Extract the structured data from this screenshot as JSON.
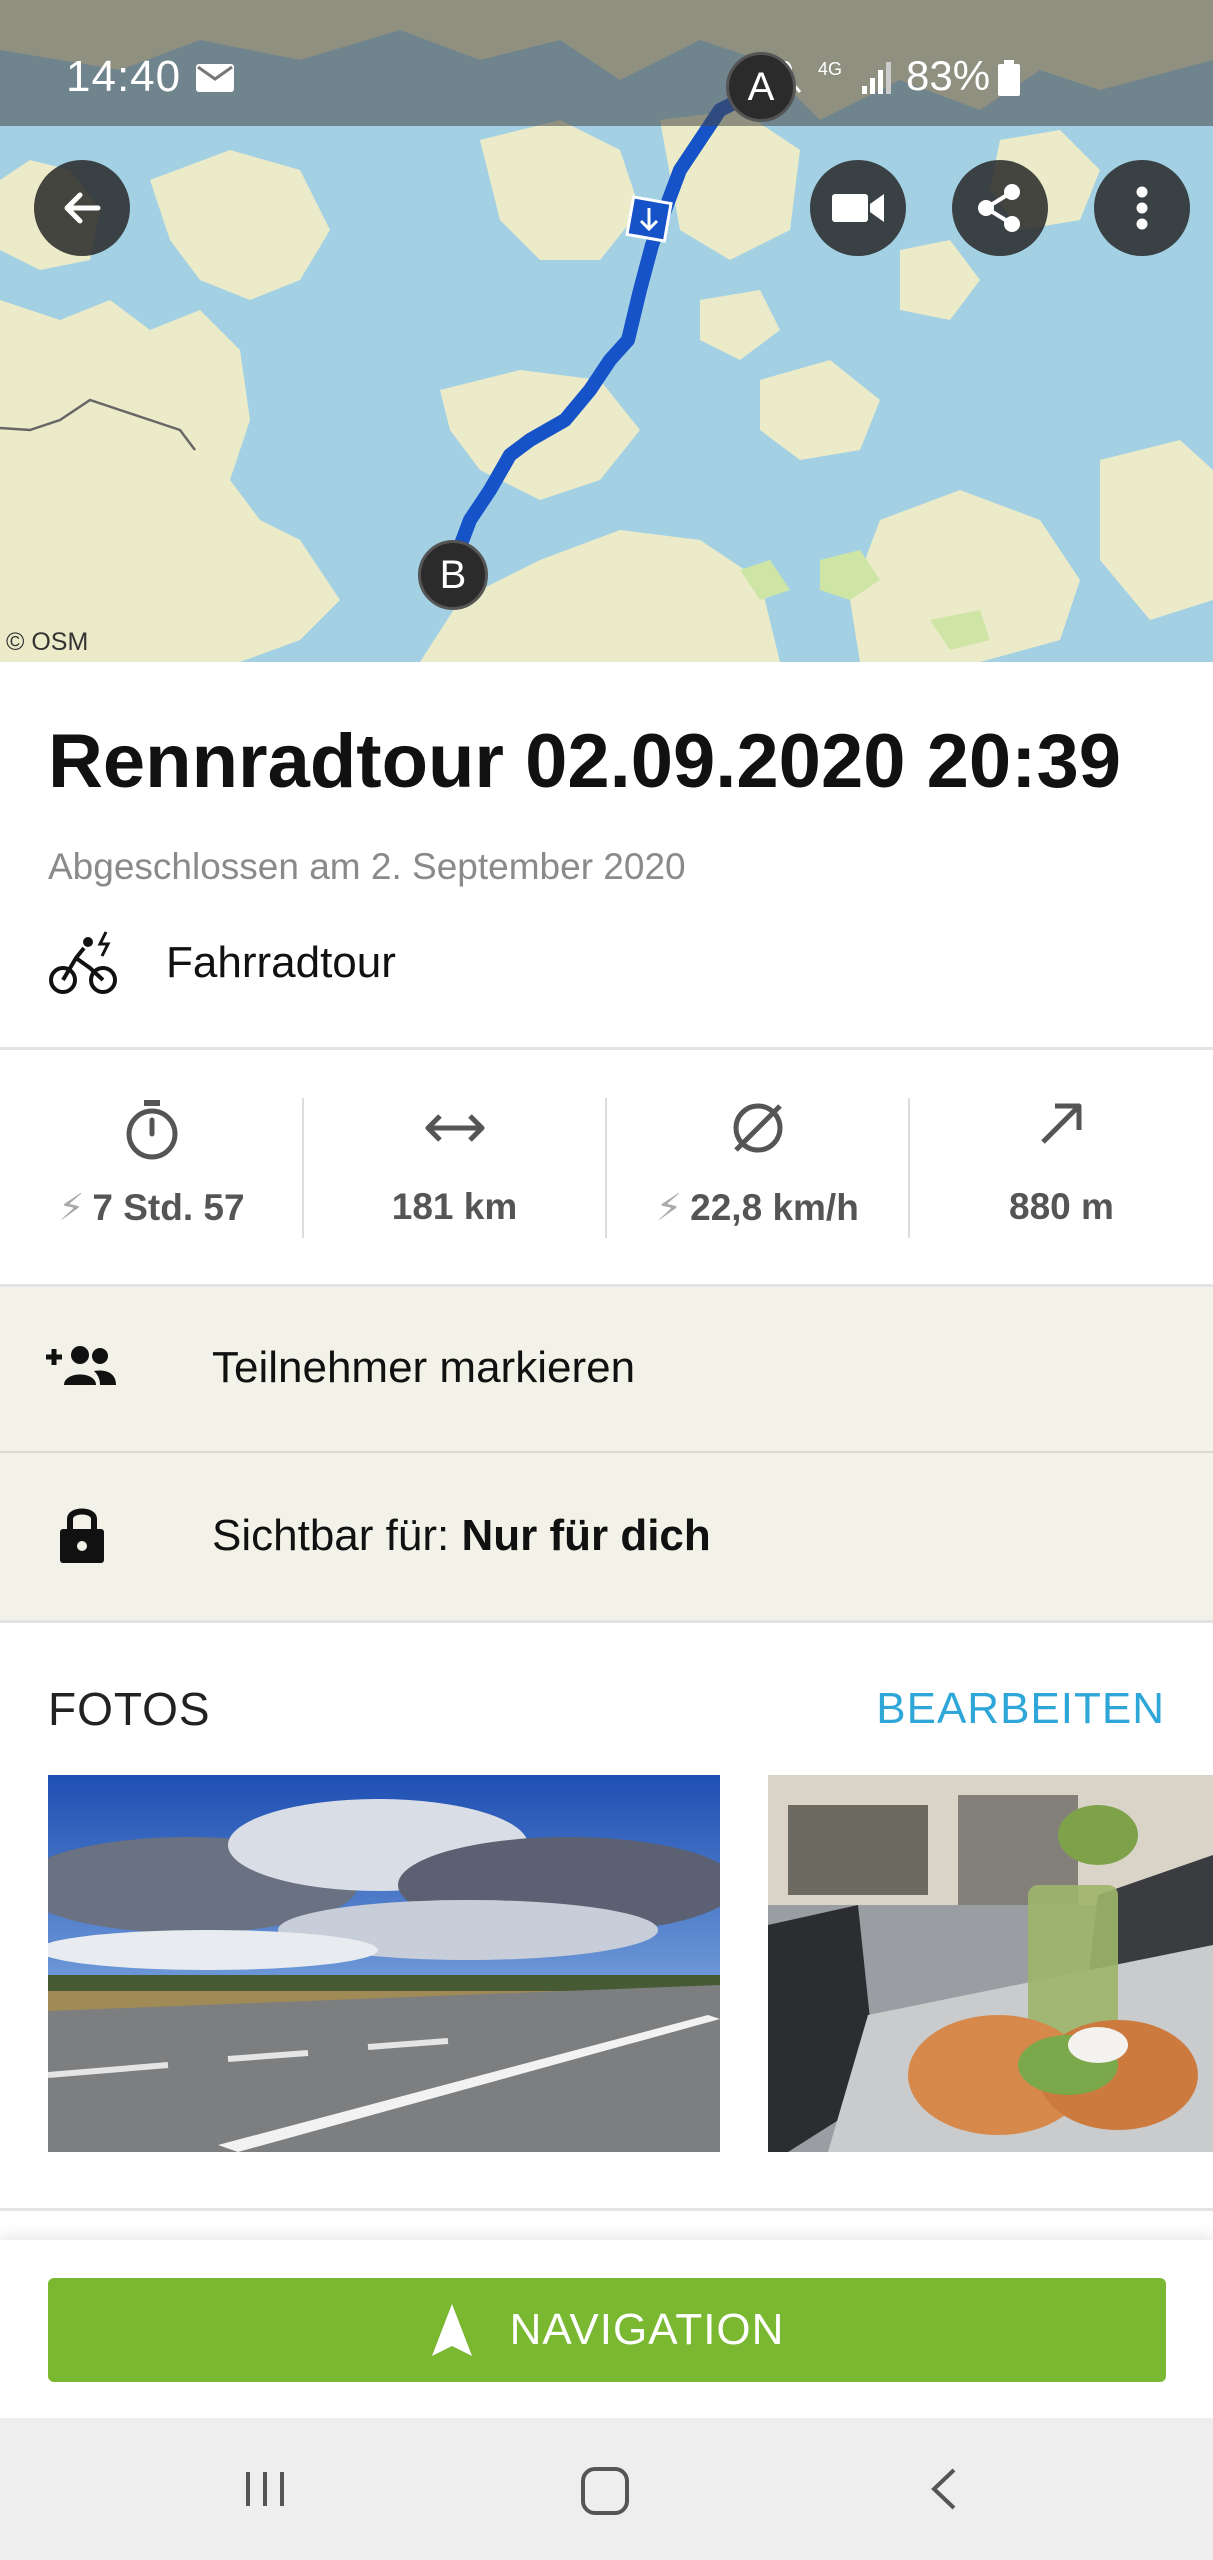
{
  "status_bar": {
    "time": "14:40",
    "network": "4G",
    "battery": "83%"
  },
  "map": {
    "osm_credit": "© OSM",
    "start_marker": "A",
    "end_marker": "B",
    "buttons": {
      "back": "back-arrow-icon",
      "video": "video-camera-icon",
      "share": "share-icon",
      "more": "more-vertical-icon"
    }
  },
  "tour": {
    "title": "Rennradtour 02.09.2020 20:39",
    "subtitle": "Abgeschlossen am 2. September 2020",
    "sport": "Fahrradtour"
  },
  "stats": {
    "duration": "7 Std. 57",
    "distance": "181 km",
    "speed": "22,8 km/h",
    "elevation": "880 m"
  },
  "participants": {
    "label": "Teilnehmer markieren"
  },
  "visibility": {
    "label": "Sichtbar für:",
    "value": "Nur für dich"
  },
  "photos": {
    "title": "FOTOS",
    "edit": "BEARBEITEN"
  },
  "navigation": {
    "label": "NAVIGATION"
  },
  "colors": {
    "accent_green": "#7bb832",
    "link_blue": "#2fa6d8",
    "route_blue": "#1652c8",
    "row_bg": "#f2f2e8"
  }
}
